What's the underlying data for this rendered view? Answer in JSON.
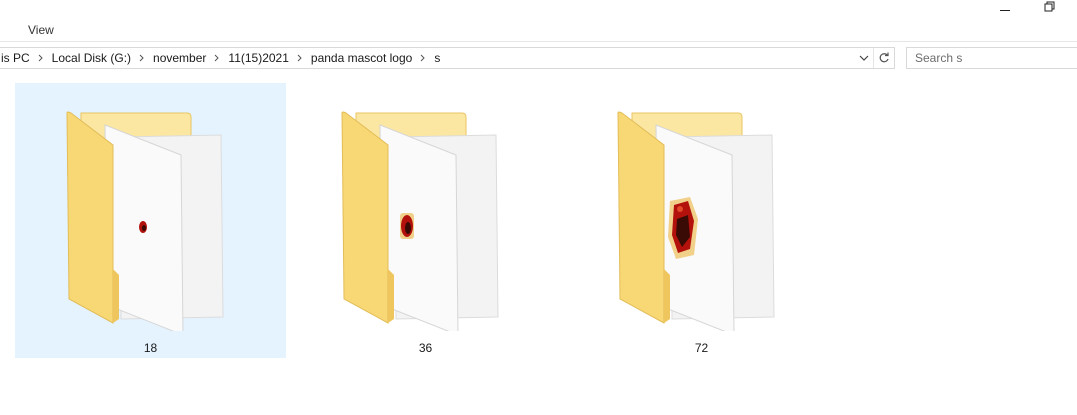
{
  "ribbon": {
    "view_tab": "View"
  },
  "address_bar": {
    "crumbs": [
      "is PC",
      "Local Disk (G:)",
      "november",
      "11(15)2021",
      "panda mascot logo",
      "s"
    ]
  },
  "search": {
    "placeholder": "Search s"
  },
  "items": [
    {
      "name": "18",
      "selected": true,
      "icon": "folder-icon"
    },
    {
      "name": "36",
      "selected": false,
      "icon": "folder-icon"
    },
    {
      "name": "72",
      "selected": false,
      "icon": "folder-icon"
    }
  ],
  "colors": {
    "selection": "#e5f3ff",
    "folder_front": "#f8d775",
    "folder_back": "#fbe6a2",
    "accent_red": "#b3120c"
  }
}
